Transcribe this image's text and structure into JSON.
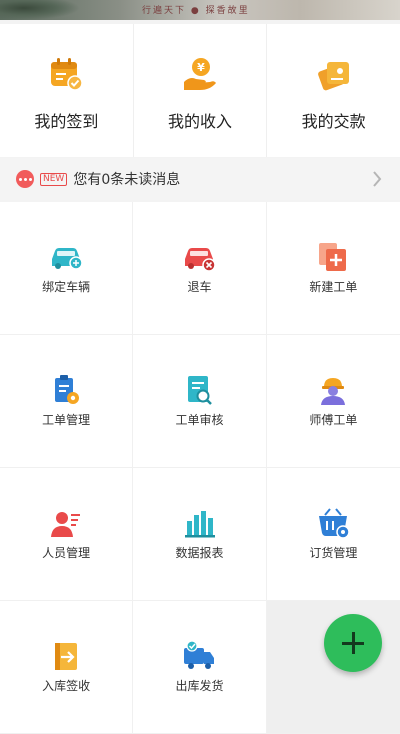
{
  "banner": {
    "caption": "行遍天下 ● 探香故里"
  },
  "top": [
    {
      "label": "我的签到",
      "icon": "calendar-check-icon"
    },
    {
      "label": "我的收入",
      "icon": "hand-coin-icon"
    },
    {
      "label": "我的交款",
      "icon": "money-card-icon"
    }
  ],
  "notice": {
    "badge": "NEW",
    "text": "您有0条未读消息",
    "icon": "message-dots-icon"
  },
  "grid": [
    {
      "label": "绑定车辆",
      "icon": "car-link-icon"
    },
    {
      "label": "退车",
      "icon": "car-remove-icon"
    },
    {
      "label": "新建工单",
      "icon": "new-order-icon"
    },
    {
      "label": "工单管理",
      "icon": "clipboard-gear-icon"
    },
    {
      "label": "工单审核",
      "icon": "document-search-icon"
    },
    {
      "label": "师傅工单",
      "icon": "worker-helmet-icon"
    },
    {
      "label": "人员管理",
      "icon": "person-list-icon"
    },
    {
      "label": "数据报表",
      "icon": "bar-chart-icon"
    },
    {
      "label": "订货管理",
      "icon": "basket-gear-icon"
    },
    {
      "label": "入库签收",
      "icon": "inbound-arrow-icon"
    },
    {
      "label": "出库发货",
      "icon": "delivery-truck-icon"
    }
  ],
  "colors": {
    "orange": "#f5a623",
    "teal": "#2fb6c8",
    "red": "#e94a4a",
    "blue": "#2f7fd6",
    "purple": "#7b6fdc",
    "green": "#2ebd5b"
  }
}
